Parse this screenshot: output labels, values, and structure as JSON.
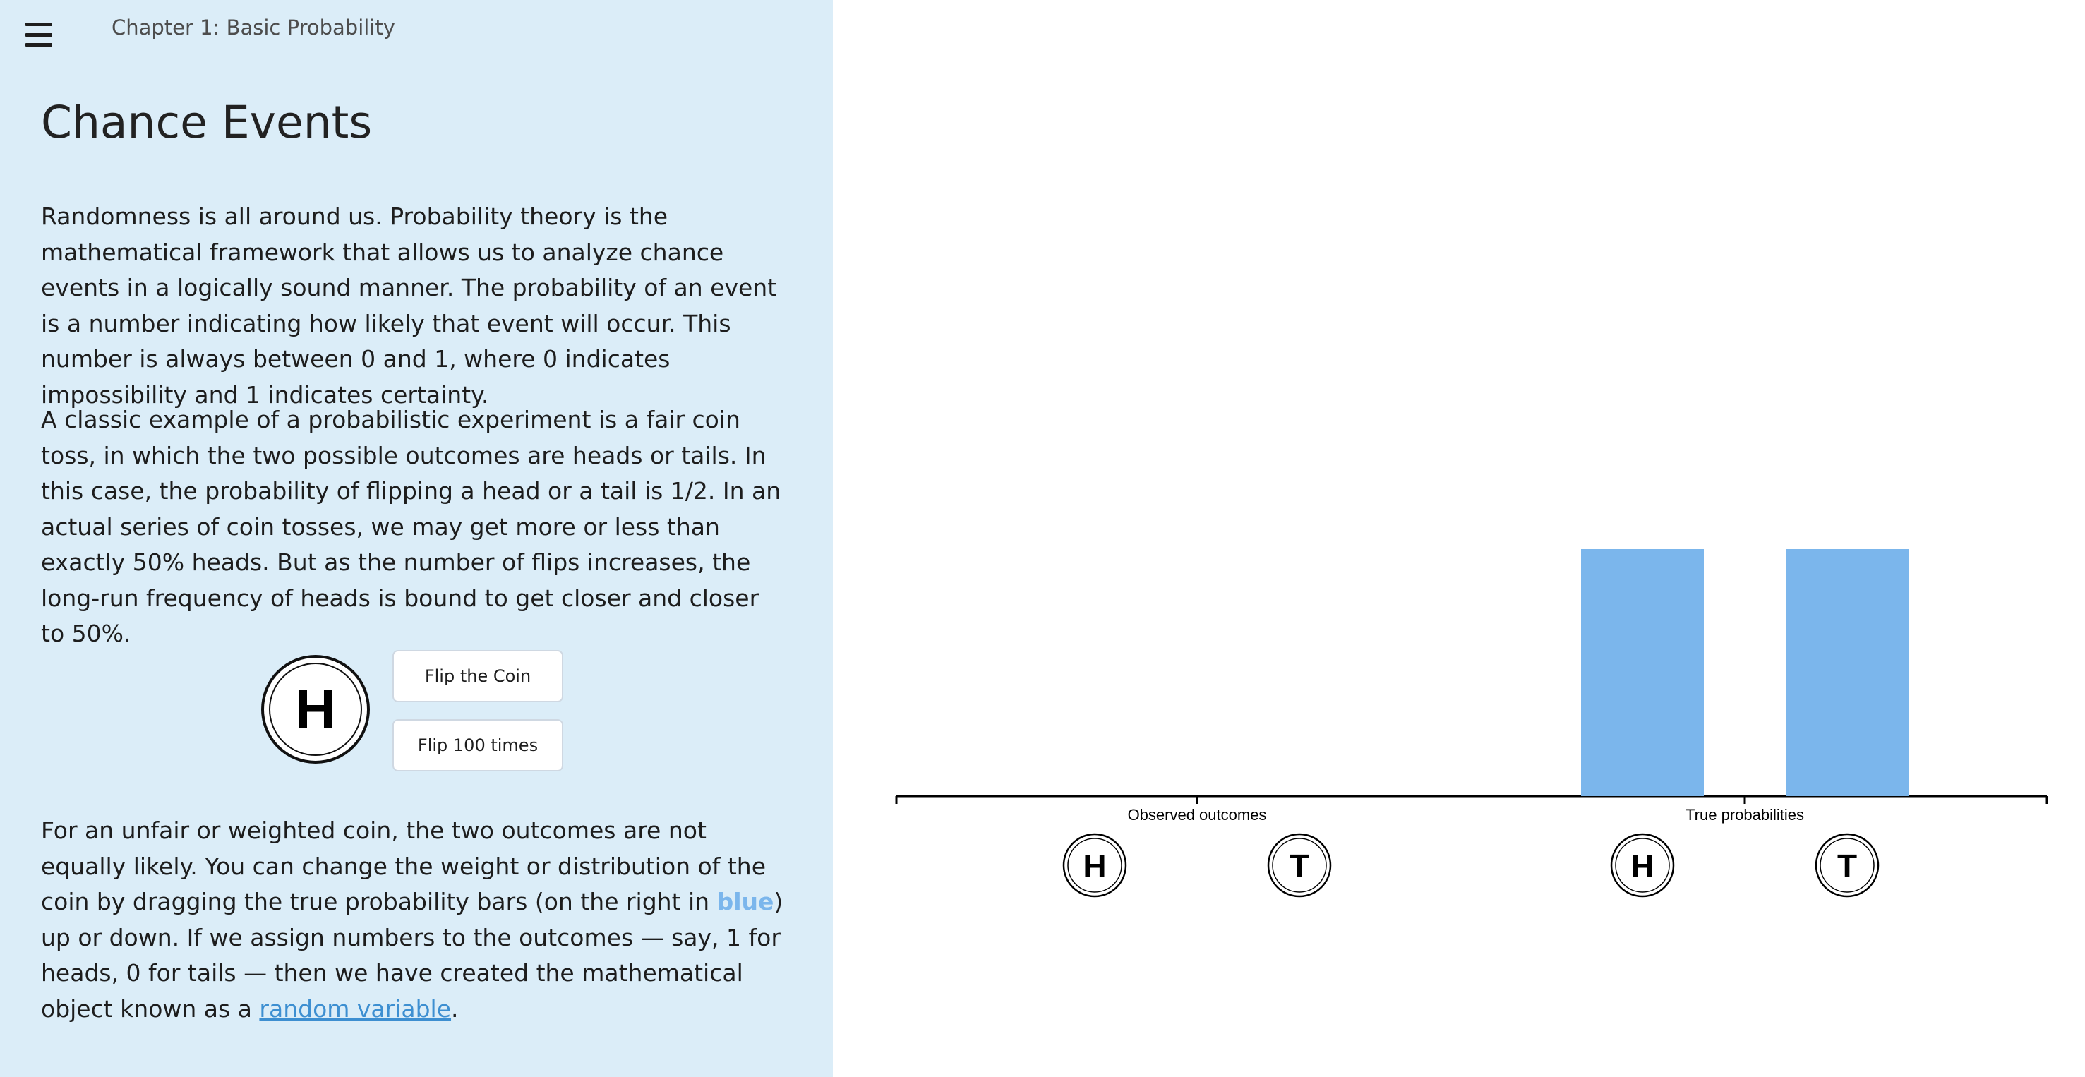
{
  "header": {
    "chapter_title": "Chapter 1: Basic Probability"
  },
  "main": {
    "title": "Chance Events",
    "paragraph1": "Randomness is all around us. Probability theory is the mathematical framework that allows us to analyze chance events in a logically sound manner. The probability of an event is a number indicating how likely that event will occur. This number is always between 0 and 1, where 0 indicates impossibility and 1 indicates certainty.",
    "paragraph2": "A classic example of a probabilistic experiment is a fair coin toss, in which the two possible outcomes are heads or tails. In this case, the probability of flipping a head or a tail is 1/2. In an actual series of coin tosses, we may get more or less than exactly 50% heads. But as the number of flips increases, the long-run frequency of heads is bound to get closer and closer to 50%.",
    "paragraph3_part1": "For an unfair or weighted coin, the two outcomes are not equally likely. You can change the weight or distribution of the coin by dragging the true probability bars (on the right in ",
    "paragraph3_highlight": "blue",
    "paragraph3_part2": ") up or down. If we assign numbers to the outcomes — say, 1 for heads, 0 for tails — then we have created the mathematical object known as a ",
    "paragraph3_link": "random variable",
    "paragraph3_end": "."
  },
  "coin": {
    "face": "H",
    "flip_label": "Flip the Coin",
    "flip100_label": "Flip 100 times"
  },
  "colors": {
    "sidebar_bg": "#dbedf8",
    "bar_fill": "#7bb6ec",
    "link": "#3d8fd1"
  },
  "chart_data": {
    "type": "bar",
    "groups": [
      {
        "label": "Observed outcomes",
        "categories": [
          "H",
          "T"
        ],
        "values": [
          0,
          0
        ]
      },
      {
        "label": "True probabilities",
        "categories": [
          "H",
          "T"
        ],
        "values": [
          0.5,
          0.5
        ]
      }
    ],
    "ylim": [
      0,
      1
    ],
    "grid": false,
    "bar_color": "#7bb6ec"
  }
}
